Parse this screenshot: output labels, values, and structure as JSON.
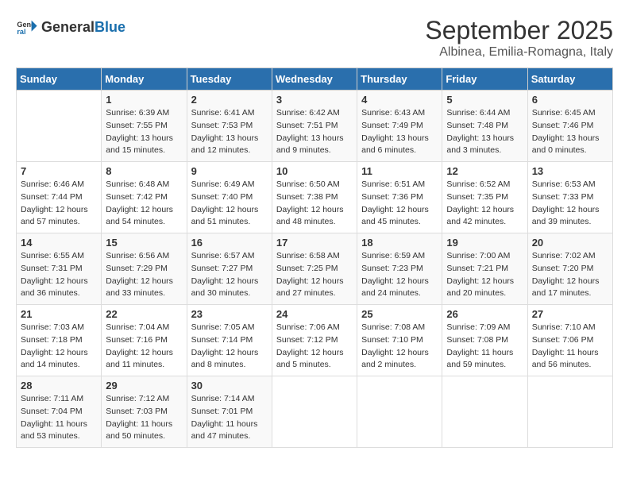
{
  "header": {
    "logo_general": "General",
    "logo_blue": "Blue",
    "month": "September 2025",
    "location": "Albinea, Emilia-Romagna, Italy"
  },
  "weekdays": [
    "Sunday",
    "Monday",
    "Tuesday",
    "Wednesday",
    "Thursday",
    "Friday",
    "Saturday"
  ],
  "weeks": [
    [
      {
        "day": "",
        "info": ""
      },
      {
        "day": "1",
        "info": "Sunrise: 6:39 AM\nSunset: 7:55 PM\nDaylight: 13 hours\nand 15 minutes."
      },
      {
        "day": "2",
        "info": "Sunrise: 6:41 AM\nSunset: 7:53 PM\nDaylight: 13 hours\nand 12 minutes."
      },
      {
        "day": "3",
        "info": "Sunrise: 6:42 AM\nSunset: 7:51 PM\nDaylight: 13 hours\nand 9 minutes."
      },
      {
        "day": "4",
        "info": "Sunrise: 6:43 AM\nSunset: 7:49 PM\nDaylight: 13 hours\nand 6 minutes."
      },
      {
        "day": "5",
        "info": "Sunrise: 6:44 AM\nSunset: 7:48 PM\nDaylight: 13 hours\nand 3 minutes."
      },
      {
        "day": "6",
        "info": "Sunrise: 6:45 AM\nSunset: 7:46 PM\nDaylight: 13 hours\nand 0 minutes."
      }
    ],
    [
      {
        "day": "7",
        "info": "Sunrise: 6:46 AM\nSunset: 7:44 PM\nDaylight: 12 hours\nand 57 minutes."
      },
      {
        "day": "8",
        "info": "Sunrise: 6:48 AM\nSunset: 7:42 PM\nDaylight: 12 hours\nand 54 minutes."
      },
      {
        "day": "9",
        "info": "Sunrise: 6:49 AM\nSunset: 7:40 PM\nDaylight: 12 hours\nand 51 minutes."
      },
      {
        "day": "10",
        "info": "Sunrise: 6:50 AM\nSunset: 7:38 PM\nDaylight: 12 hours\nand 48 minutes."
      },
      {
        "day": "11",
        "info": "Sunrise: 6:51 AM\nSunset: 7:36 PM\nDaylight: 12 hours\nand 45 minutes."
      },
      {
        "day": "12",
        "info": "Sunrise: 6:52 AM\nSunset: 7:35 PM\nDaylight: 12 hours\nand 42 minutes."
      },
      {
        "day": "13",
        "info": "Sunrise: 6:53 AM\nSunset: 7:33 PM\nDaylight: 12 hours\nand 39 minutes."
      }
    ],
    [
      {
        "day": "14",
        "info": "Sunrise: 6:55 AM\nSunset: 7:31 PM\nDaylight: 12 hours\nand 36 minutes."
      },
      {
        "day": "15",
        "info": "Sunrise: 6:56 AM\nSunset: 7:29 PM\nDaylight: 12 hours\nand 33 minutes."
      },
      {
        "day": "16",
        "info": "Sunrise: 6:57 AM\nSunset: 7:27 PM\nDaylight: 12 hours\nand 30 minutes."
      },
      {
        "day": "17",
        "info": "Sunrise: 6:58 AM\nSunset: 7:25 PM\nDaylight: 12 hours\nand 27 minutes."
      },
      {
        "day": "18",
        "info": "Sunrise: 6:59 AM\nSunset: 7:23 PM\nDaylight: 12 hours\nand 24 minutes."
      },
      {
        "day": "19",
        "info": "Sunrise: 7:00 AM\nSunset: 7:21 PM\nDaylight: 12 hours\nand 20 minutes."
      },
      {
        "day": "20",
        "info": "Sunrise: 7:02 AM\nSunset: 7:20 PM\nDaylight: 12 hours\nand 17 minutes."
      }
    ],
    [
      {
        "day": "21",
        "info": "Sunrise: 7:03 AM\nSunset: 7:18 PM\nDaylight: 12 hours\nand 14 minutes."
      },
      {
        "day": "22",
        "info": "Sunrise: 7:04 AM\nSunset: 7:16 PM\nDaylight: 12 hours\nand 11 minutes."
      },
      {
        "day": "23",
        "info": "Sunrise: 7:05 AM\nSunset: 7:14 PM\nDaylight: 12 hours\nand 8 minutes."
      },
      {
        "day": "24",
        "info": "Sunrise: 7:06 AM\nSunset: 7:12 PM\nDaylight: 12 hours\nand 5 minutes."
      },
      {
        "day": "25",
        "info": "Sunrise: 7:08 AM\nSunset: 7:10 PM\nDaylight: 12 hours\nand 2 minutes."
      },
      {
        "day": "26",
        "info": "Sunrise: 7:09 AM\nSunset: 7:08 PM\nDaylight: 11 hours\nand 59 minutes."
      },
      {
        "day": "27",
        "info": "Sunrise: 7:10 AM\nSunset: 7:06 PM\nDaylight: 11 hours\nand 56 minutes."
      }
    ],
    [
      {
        "day": "28",
        "info": "Sunrise: 7:11 AM\nSunset: 7:04 PM\nDaylight: 11 hours\nand 53 minutes."
      },
      {
        "day": "29",
        "info": "Sunrise: 7:12 AM\nSunset: 7:03 PM\nDaylight: 11 hours\nand 50 minutes."
      },
      {
        "day": "30",
        "info": "Sunrise: 7:14 AM\nSunset: 7:01 PM\nDaylight: 11 hours\nand 47 minutes."
      },
      {
        "day": "",
        "info": ""
      },
      {
        "day": "",
        "info": ""
      },
      {
        "day": "",
        "info": ""
      },
      {
        "day": "",
        "info": ""
      }
    ]
  ]
}
